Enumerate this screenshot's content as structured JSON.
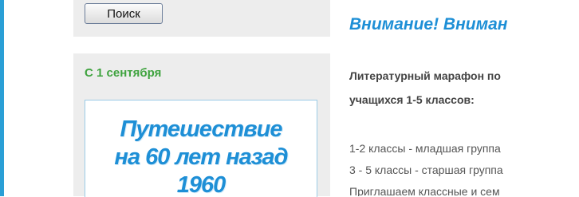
{
  "sidebar": {
    "search_button_label": "Поиск",
    "news": {
      "date": "С 1 сентября",
      "banner": {
        "line1": "Путешествие",
        "line2": "на 60 лет назад",
        "line3": "1960"
      }
    }
  },
  "main": {
    "top_cut_text": "",
    "heading": "Внимание! Вниман",
    "marathon_line1": "Литературный марафон по",
    "marathon_line2": "учащихся 1-5 классов:",
    "class_lines": [
      "1-2 классы - младшая группа",
      "3 - 5 классы - старшая группа",
      "Приглашаем классные и сем"
    ]
  },
  "colors": {
    "accent_blue": "#1e8fd6",
    "date_green": "#3fa33f",
    "panel_grey": "#ededed",
    "left_rule": "#2a9fd6"
  }
}
